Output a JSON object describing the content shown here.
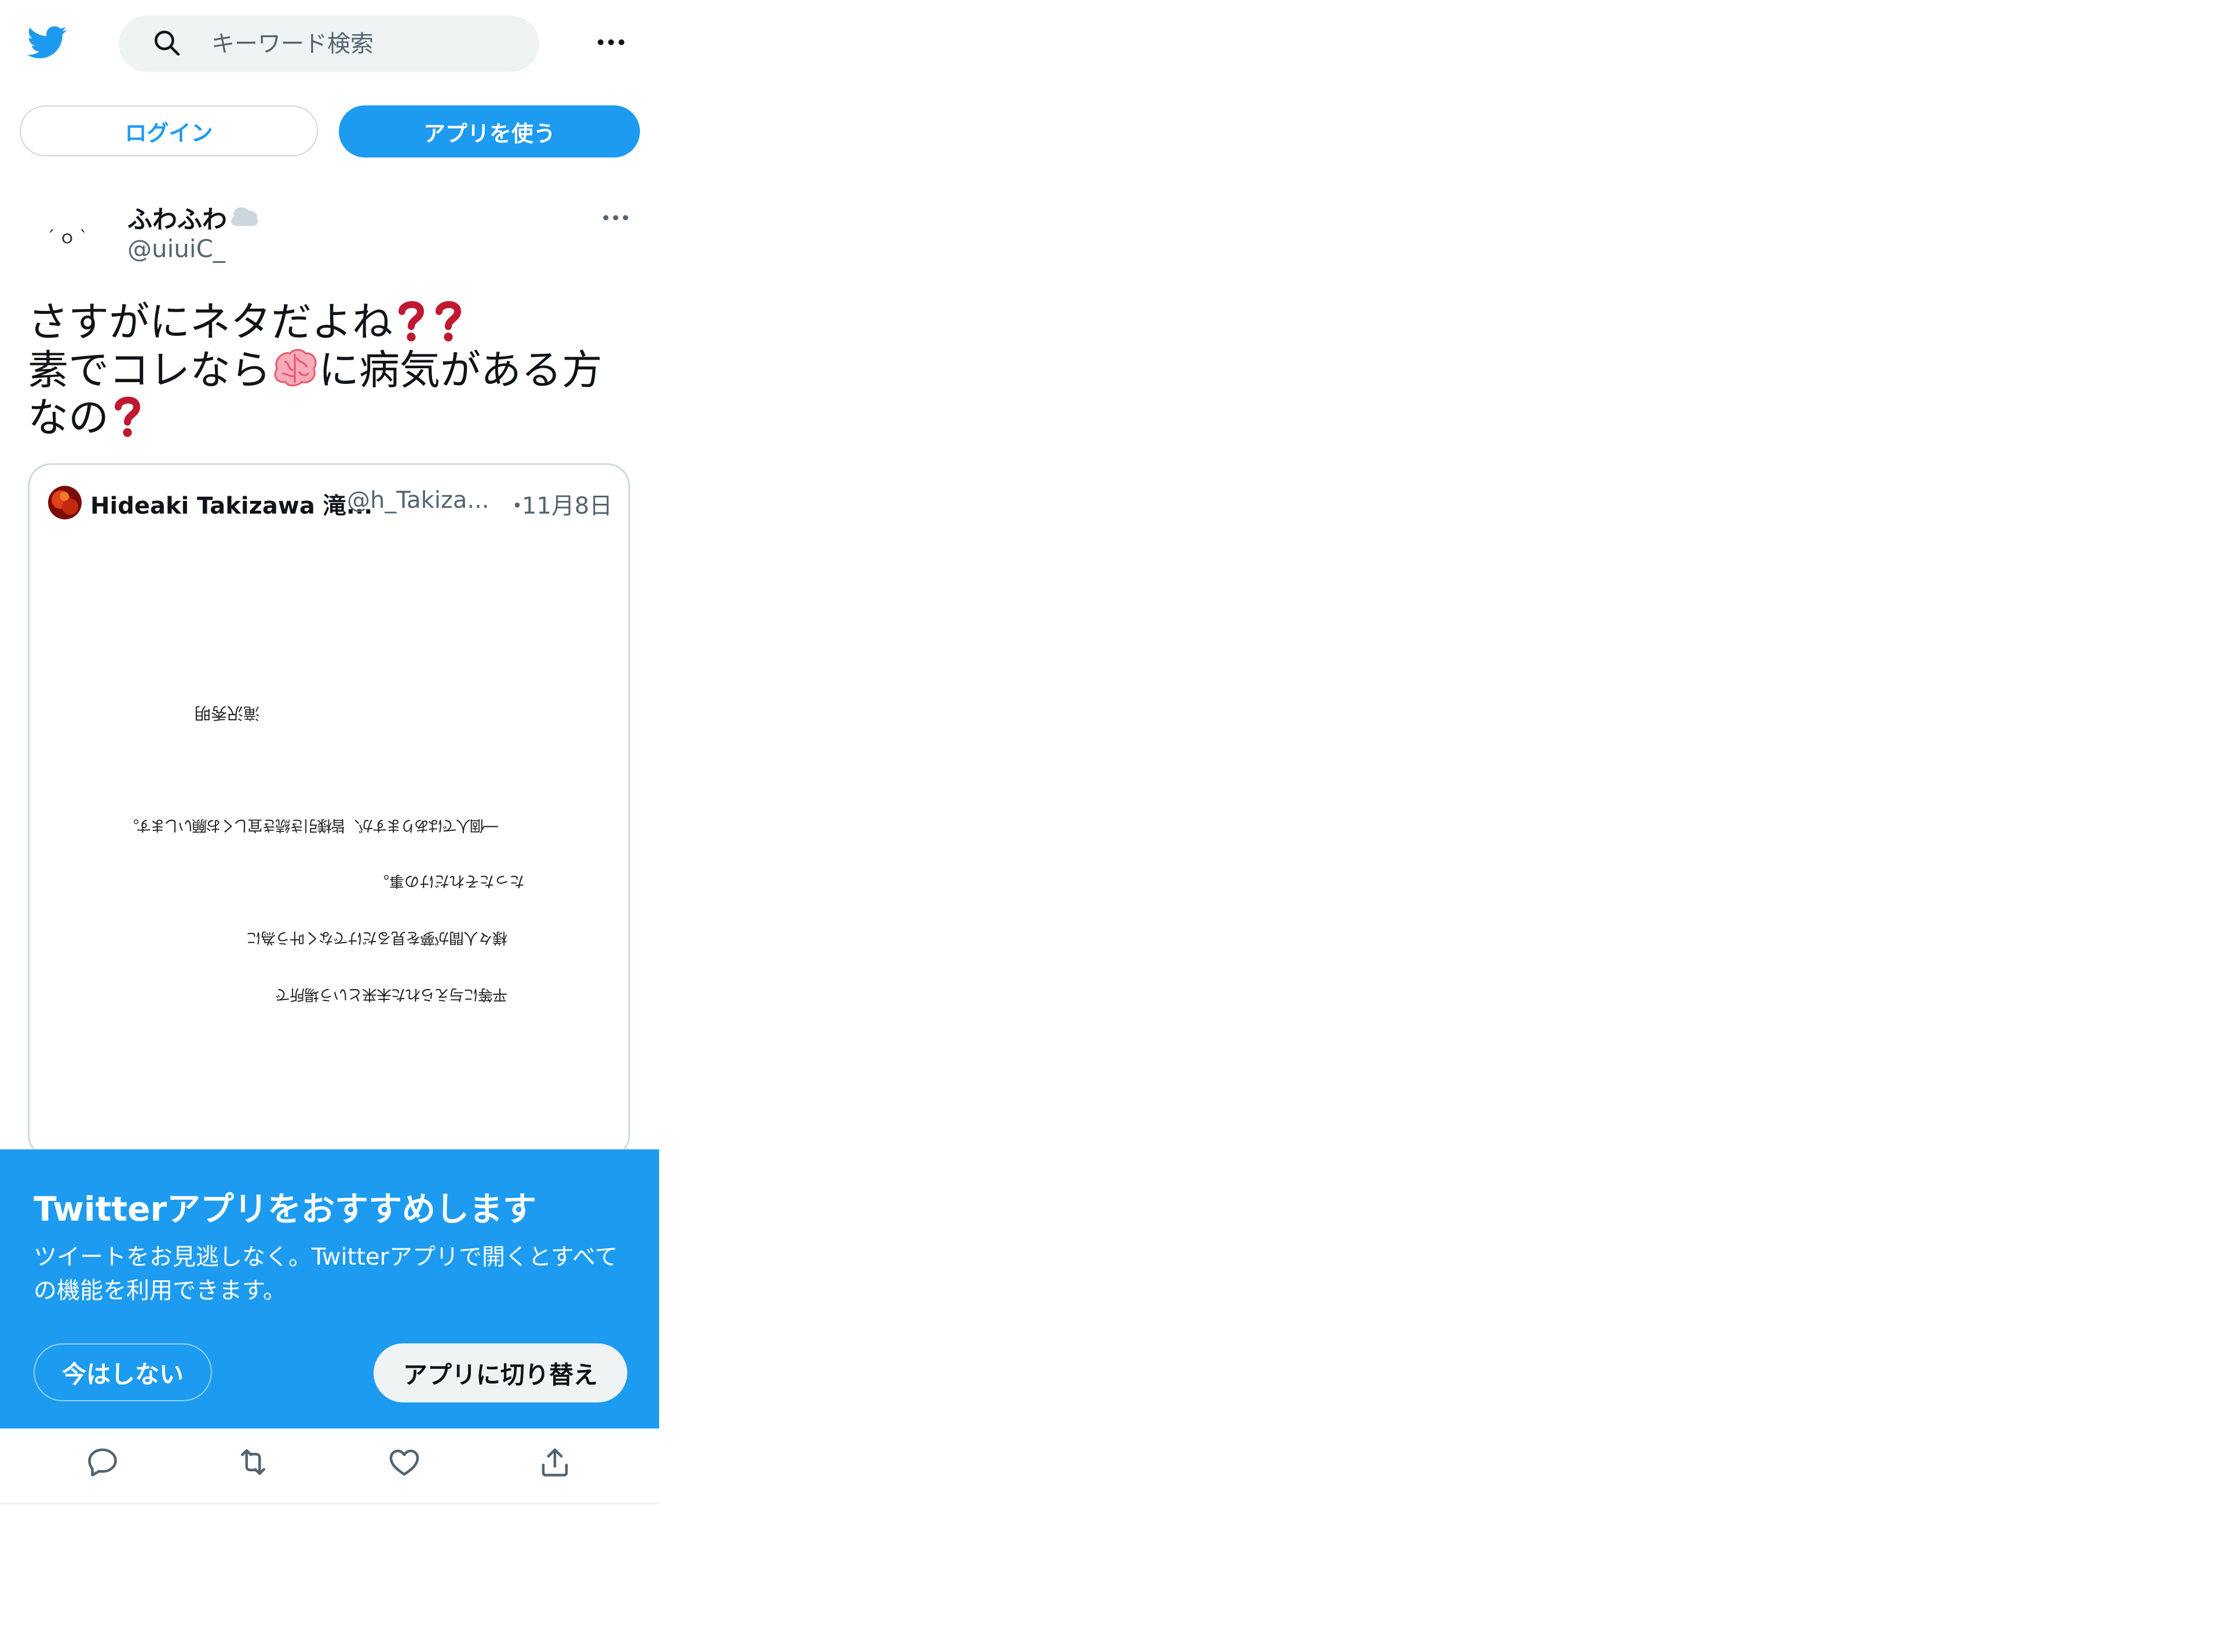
{
  "header": {
    "search_placeholder": "キーワード検索"
  },
  "auth": {
    "login_label": "ログイン",
    "use_app_label": "アプリを使う"
  },
  "tweet": {
    "display_name": "ふわふわ",
    "handle": "@uiuiC_",
    "avatar_face": "´ｏ`",
    "line1": "さすがにネタだよね",
    "line2a": "素でコレなら",
    "line2b": "に病気がある方",
    "line3": "なの"
  },
  "quote": {
    "name": "Hideaki Takizawa 滝...",
    "handle": "@h_Takiza...",
    "separator": "・",
    "date": "11月8日",
    "image_lines": [
      "滝沢秀明",
      "一個人ではありますが、皆様引き続き宜しくお願いします。",
      "たったそれだけの事。",
      "様々人間が夢を見るだけでなく叶う為に",
      "平等に与えられた未来という場所で"
    ]
  },
  "banner": {
    "title": "Twitterアプリをおすすめします",
    "description": "ツイートをお見逃しなく。Twitterアプリで開くとすべての機能を利用できます。",
    "not_now_label": "今はしない",
    "switch_label": "アプリに切り替え"
  },
  "colors": {
    "accent": "#1d9bf0",
    "text_primary": "#0f1419",
    "text_secondary": "#536471",
    "border": "#cfd9de",
    "emoji_red": "#be1931"
  },
  "icons": [
    "twitter-logo-icon",
    "search-icon",
    "more-icon",
    "cloud-icon",
    "question-mark-icon",
    "brain-icon",
    "reply-icon",
    "retweet-icon",
    "like-icon",
    "share-icon"
  ]
}
